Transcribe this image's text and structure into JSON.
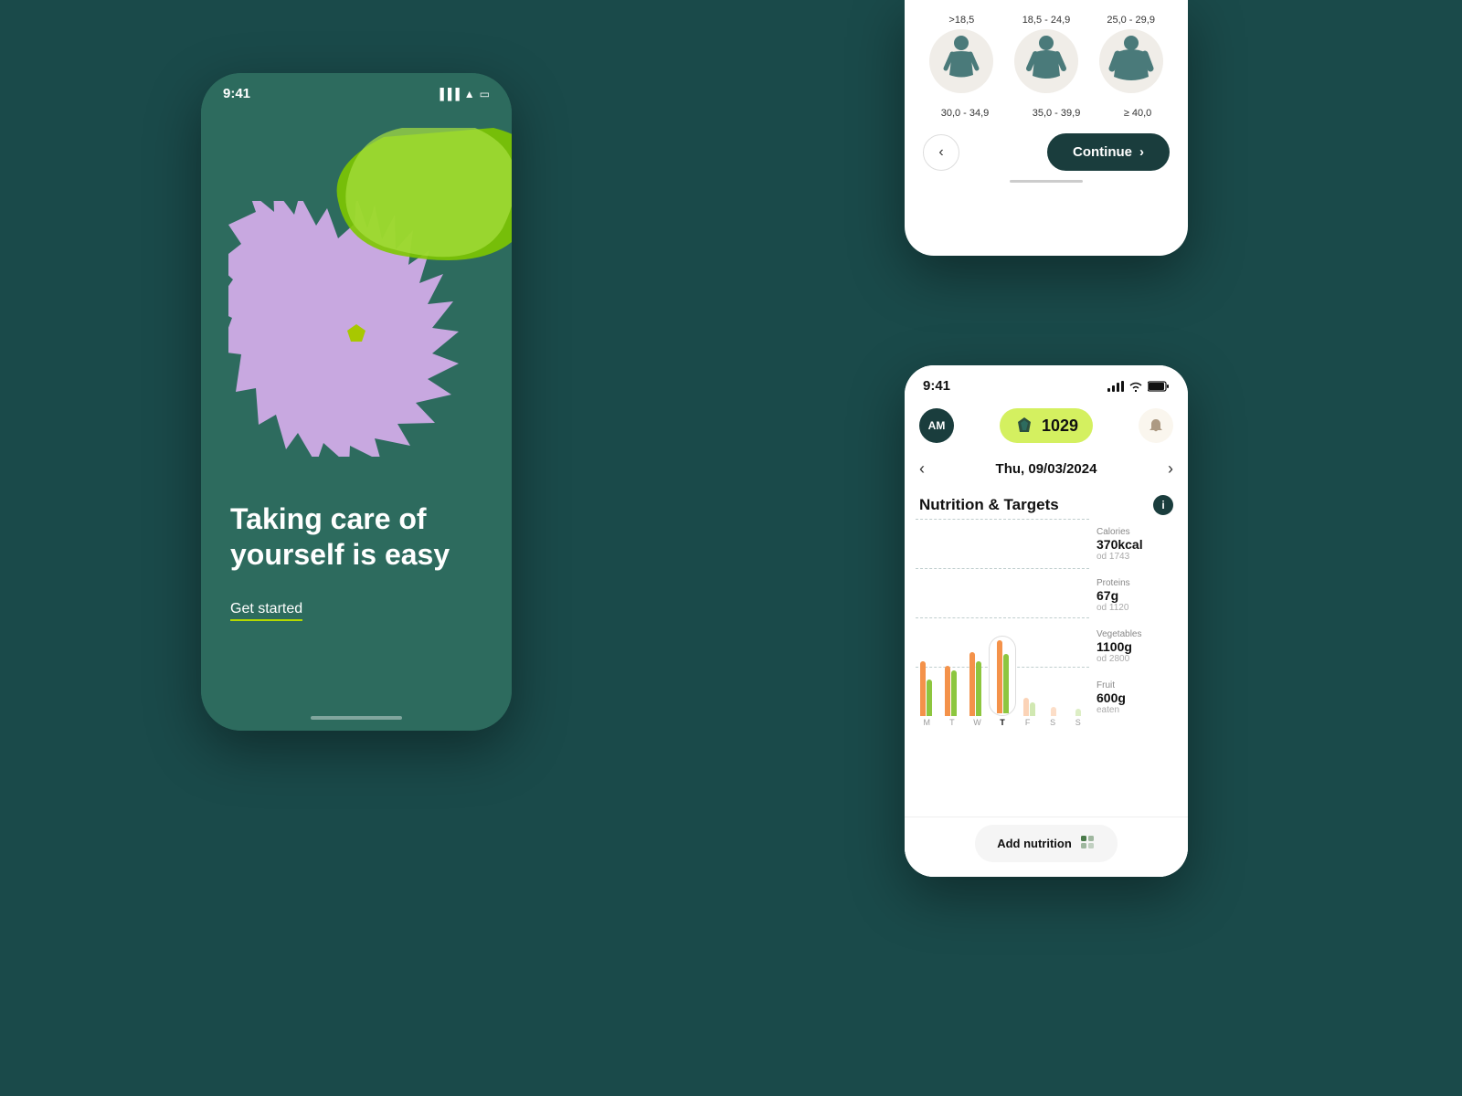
{
  "background": {
    "color": "#1a4a4a"
  },
  "phone_left": {
    "status_time": "9:41",
    "headline": "Taking care of yourself is easy",
    "cta_label": "Get started"
  },
  "phone_top_right": {
    "bmi_ranges_top": [
      ">18,5",
      "18,5 - 24,9",
      "25,0 - 29,9"
    ],
    "bmi_ranges_bottom": [
      "30,0 - 34,9",
      "35,0 - 39,9",
      "≥ 40,0"
    ],
    "back_arrow": "‹",
    "continue_label": "Continue",
    "continue_arrow": "›"
  },
  "phone_bottom_right": {
    "status_time": "9:41",
    "avatar_initials": "AM",
    "calorie_count": "1029",
    "bell_icon": "🔔",
    "date": "Thu, 09/03/2024",
    "prev_arrow": "‹",
    "next_arrow": "›",
    "section_title": "Nutrition & Targets",
    "info_label": "i",
    "stats": [
      {
        "name": "Calories",
        "value": "370kcal",
        "sub": "od 1743"
      },
      {
        "name": "Proteins",
        "value": "67g",
        "sub": "od 1120"
      },
      {
        "name": "Vegetables",
        "value": "1100g",
        "sub": "od 2800"
      },
      {
        "name": "Fruit",
        "value": "600g",
        "sub": "eaten"
      }
    ],
    "days": [
      "M",
      "T",
      "W",
      "T",
      "F",
      "S",
      "S"
    ],
    "selected_day_index": 3,
    "add_btn_label": "Add nutrition",
    "add_btn_icon": "+"
  }
}
